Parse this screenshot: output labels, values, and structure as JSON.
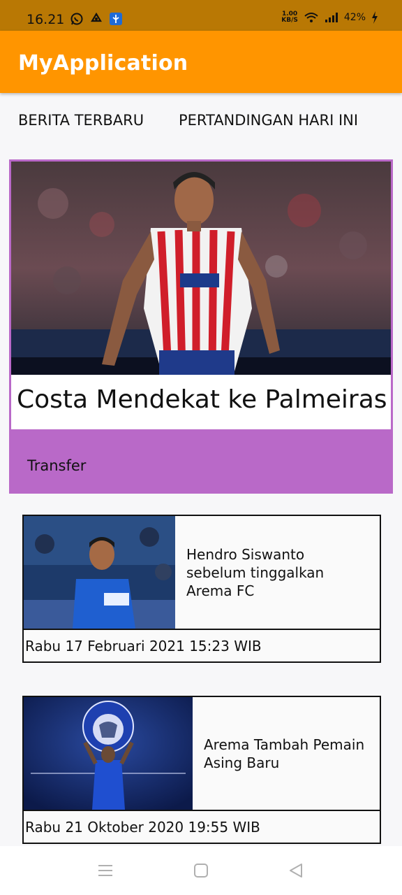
{
  "status_bar": {
    "time": "16.21",
    "net_speed_value": "1.00",
    "net_speed_unit": "KB/S",
    "battery": "42%"
  },
  "app": {
    "title": "MyApplication"
  },
  "tabs": [
    {
      "label": "BERITA TERBARU"
    },
    {
      "label": "PERTANDINGAN HARI INI"
    }
  ],
  "featured": {
    "title": "Costa Mendekat ke Palmeiras",
    "category": "Transfer"
  },
  "articles": [
    {
      "headline_lines": [
        "Hendro Siswanto",
        "sebelum tinggalkan",
        "Arema FC"
      ],
      "date": "Rabu 17 Februari 2021 15:23 WIB"
    },
    {
      "headline_lines": [
        "Arema Tambah Pemain",
        "Asing Baru"
      ],
      "date": "Rabu 21 Oktober 2020 19:55 WIB"
    }
  ],
  "colors": {
    "status_bar": "#b97804",
    "app_bar": "#ff9500",
    "featured_accent": "#b969c8"
  },
  "icons": [
    "whatsapp-icon",
    "recycle-icon",
    "usb-debug-icon",
    "wifi-icon",
    "signal-icon",
    "battery-charging-icon",
    "menu-icon",
    "home-icon",
    "back-icon"
  ]
}
